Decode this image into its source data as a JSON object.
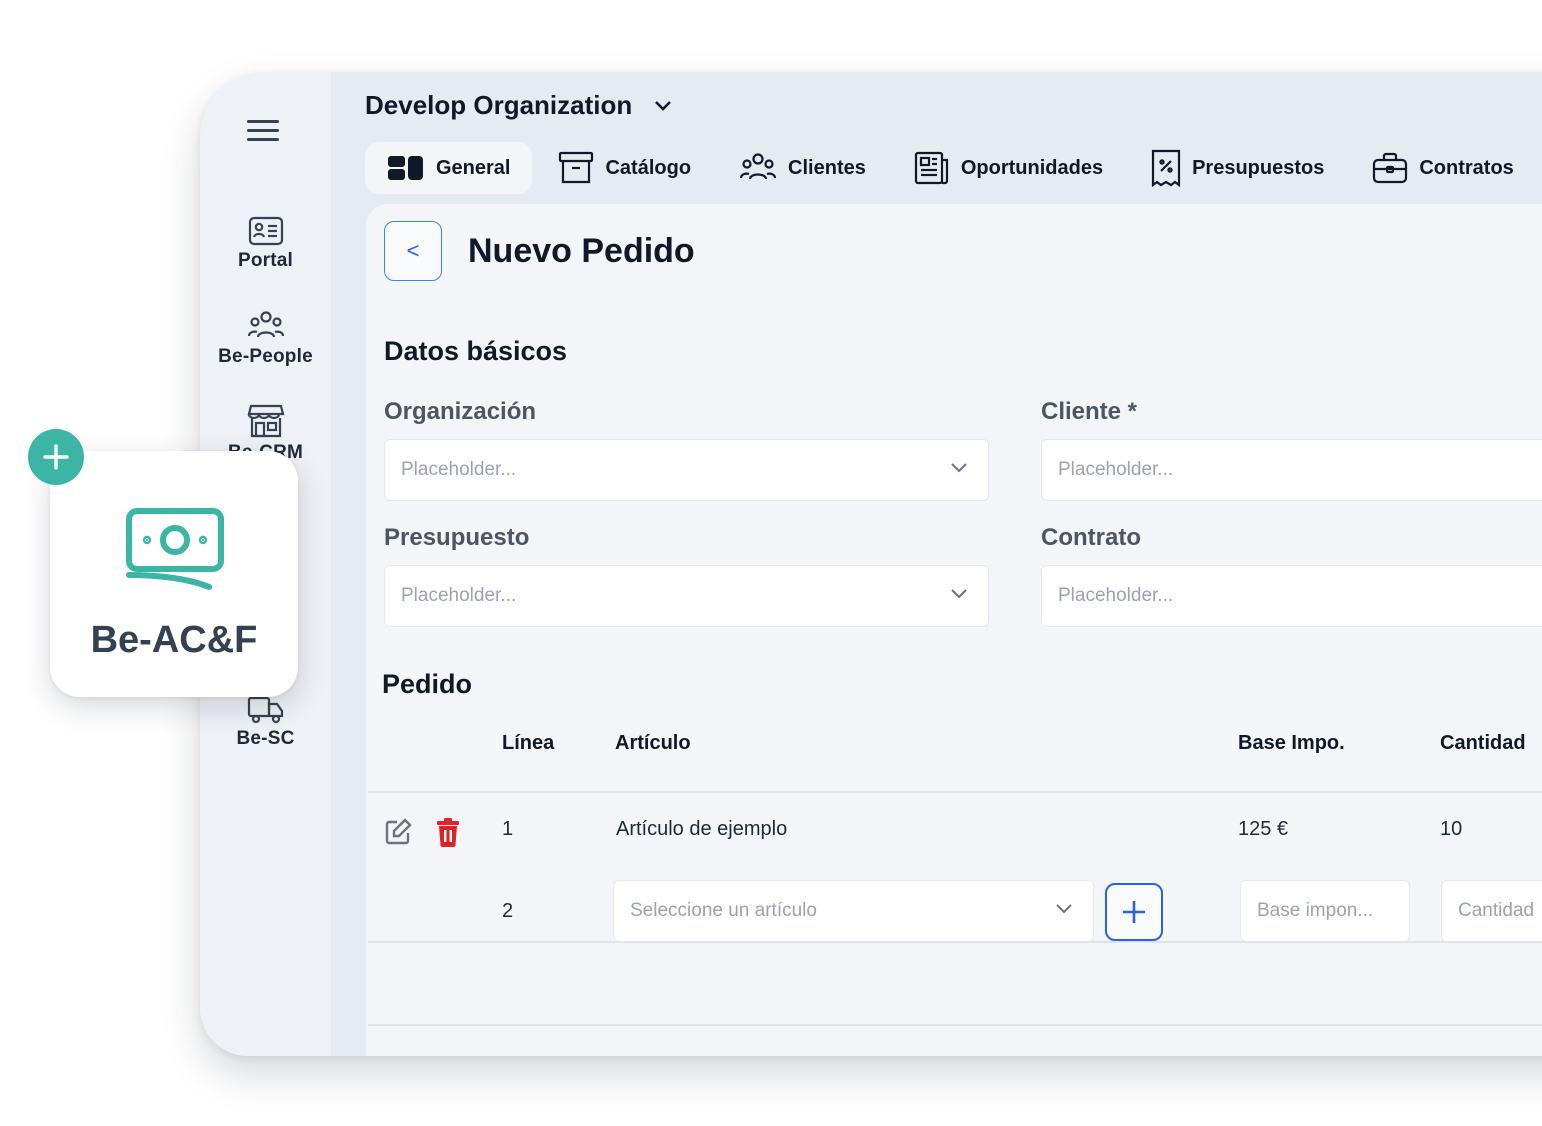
{
  "sidebar": {
    "items": [
      {
        "label": "Portal",
        "icon": "id-card-icon"
      },
      {
        "label": "Be-People",
        "icon": "people-icon"
      },
      {
        "label": "Be-CRM",
        "icon": "store-icon"
      },
      {
        "label": "Be-SC",
        "icon": "truck-icon"
      }
    ]
  },
  "header": {
    "organization": "Develop Organization",
    "tabs": [
      {
        "label": "General",
        "icon": "blocks-icon"
      },
      {
        "label": "Catálogo",
        "icon": "archive-icon"
      },
      {
        "label": "Clientes",
        "icon": "people-icon"
      },
      {
        "label": "Oportunidades",
        "icon": "newspaper-icon"
      },
      {
        "label": "Presupuestos",
        "icon": "receipt-icon"
      },
      {
        "label": "Contratos",
        "icon": "briefcase-icon"
      },
      {
        "label": "",
        "icon": "truck-icon"
      }
    ]
  },
  "page": {
    "back_label": "<",
    "title": "Nuevo Pedido",
    "basic_section": "Datos básicos",
    "fields": {
      "organizacion": {
        "label": "Organización",
        "placeholder": "Placeholder..."
      },
      "cliente": {
        "label": "Cliente *",
        "placeholder": "Placeholder..."
      },
      "presupuesto": {
        "label": "Presupuesto",
        "placeholder": "Placeholder..."
      },
      "contrato": {
        "label": "Contrato",
        "placeholder": "Placeholder..."
      }
    },
    "order_section": "Pedido",
    "table": {
      "headers": [
        "Línea",
        "Artículo",
        "Base Impo.",
        "Cantidad"
      ],
      "rows": [
        {
          "linea": "1",
          "articulo": "Artículo de  ejemplo",
          "base": "125 €",
          "cantidad": "10"
        }
      ],
      "new_row": {
        "linea": "2",
        "article_placeholder": "Seleccione un artículo",
        "base_placeholder": "Base impon...",
        "cantidad_placeholder": "Cantidad"
      }
    }
  },
  "floating_card": {
    "label": "Be-AC&F",
    "icon": "money-icon",
    "badge_icon": "plus-icon"
  },
  "colors": {
    "accent": "#3bb5a5",
    "primary": "#2563eb",
    "danger": "#dc2626"
  }
}
